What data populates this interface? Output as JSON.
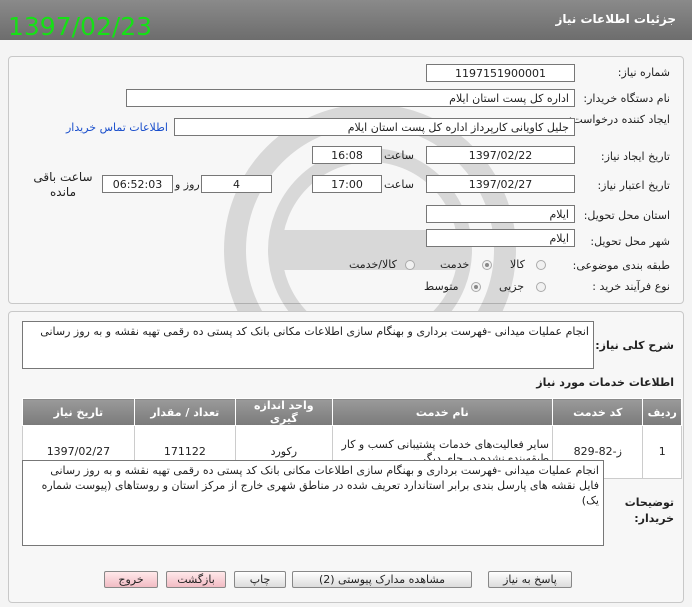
{
  "header": {
    "title": "جزئیات اطلاعات نیاز",
    "date_overlay": "1397/02/23"
  },
  "form": {
    "need_number": {
      "label": "شماره نیاز:",
      "value": "1197151900001"
    },
    "buyer_org": {
      "label": "نام دستگاه خریدار:",
      "value": "اداره کل پست استان ایلام"
    },
    "creator": {
      "label": "ایجاد کننده درخواست:",
      "value": "جلیل کاویانی کارپرداز اداره کل پست استان ایلام",
      "contact_link": "اطلاعات تماس خریدار"
    },
    "created": {
      "label": "تاریخ ایجاد نیاز:",
      "date": "1397/02/22",
      "time_label": "ساعت",
      "time": "16:08"
    },
    "validity": {
      "label": "تاریخ اعتبار نیاز:",
      "date": "1397/02/27",
      "time_label": "ساعت",
      "time": "17:00",
      "days": "4",
      "days_label": "روز و",
      "remaining": "06:52:03",
      "remaining_label": "ساعت باقی مانده"
    },
    "province": {
      "label": "استان محل تحویل:",
      "value": "ایلام"
    },
    "city": {
      "label": "شهر محل تحویل:",
      "value": "ایلام"
    },
    "category": {
      "label": "طبقه بندی موضوعی:",
      "options": [
        "کالا",
        "خدمت",
        "کالا/خدمت"
      ],
      "selected": "خدمت"
    },
    "process": {
      "label": "نوع فرآیند خرید :",
      "options": [
        "جزیی",
        "متوسط"
      ],
      "selected": "متوسط"
    }
  },
  "summary": {
    "label": "شرح کلی نیاز:",
    "text": "انجام عملیات میدانی -فهرست برداری و بهنگام سازی اطلاعات مکانی بانک کد پستی ده رقمی تهیه نقشه و به روز رسانی"
  },
  "services": {
    "title": "اطلاعات خدمات مورد نیاز",
    "columns": [
      "ردیف",
      "کد خدمت",
      "نام خدمت",
      "واحد اندازه گیری",
      "تعداد / مقدار",
      "تاریخ نیاز"
    ],
    "rows": [
      [
        "1",
        "ز-82-829",
        "سایر فعالیت‌های خدمات پشتیبانی کسب و کار طبقه‌بندی‌نشده در جای دیگر",
        "رکورد",
        "171122",
        "1397/02/27"
      ]
    ]
  },
  "buyer_notes": {
    "label": "توضیحات خریدار:",
    "text": "انجام عملیات میدانی -فهرست برداری و بهنگام سازی اطلاعات مکانی بانک کد پستی ده رقمی تهیه نقشه و به روز رسانی فایل نقشه های پارسل بندی برابر استاندارد تعریف شده در مناطق شهری خارج از مرکز استان و روستاهای (پیوست شماره یک)"
  },
  "buttons": {
    "reply": "پاسخ به نیاز",
    "docs": "مشاهده مدارک پیوستی (2)",
    "print": "چاپ",
    "back": "بازگشت",
    "exit": "خروج"
  }
}
